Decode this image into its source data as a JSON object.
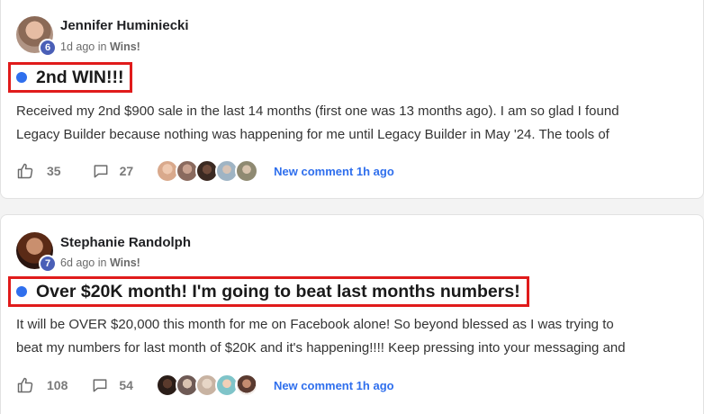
{
  "posts": [
    {
      "author": "Jennifer Huminiecki",
      "level": "6",
      "time": "1d ago",
      "in_label": "in",
      "category": "Wins!",
      "title": "2nd WIN!!!",
      "body_lines": [
        "Received my 2nd $900 sale in the last 14 months (first one was 13 months ago). I am so glad I found",
        "Legacy Builder because nothing was happening for me until Legacy Builder in May '24. The tools of"
      ],
      "likes": "35",
      "comments": "27",
      "new_comment": "New comment 1h ago",
      "commenter_avatars": [
        "#d9a98c",
        "#8a6a5e",
        "#3b2a22",
        "#9fb4c4",
        "#b6b09a"
      ]
    },
    {
      "author": "Stephanie Randolph",
      "level": "7",
      "time": "6d ago",
      "in_label": "in",
      "category": "Wins!",
      "title": "Over $20K month! I'm going to beat last months numbers!",
      "body_lines": [
        "It will be OVER $20,000 this month for me on Facebook alone! So beyond blessed as I was trying to",
        "beat my numbers for last month of $20K and it's happening!!!! Keep pressing into your messaging and"
      ],
      "likes": "108",
      "comments": "54",
      "new_comment": "New comment 1h ago",
      "commenter_avatars": [
        "#2a1d18",
        "#6e5a55",
        "#c8b3a2",
        "#7fc4c9",
        "#5a3a30"
      ]
    }
  ],
  "colors": {
    "accent_blue": "#2f6fed",
    "highlight_red": "#e01b1b",
    "level_badge": "#4a5fb7"
  },
  "icons": {
    "like": "thumbs-up-icon",
    "comment": "speech-bubble-icon",
    "unread": "unread-dot-icon"
  }
}
